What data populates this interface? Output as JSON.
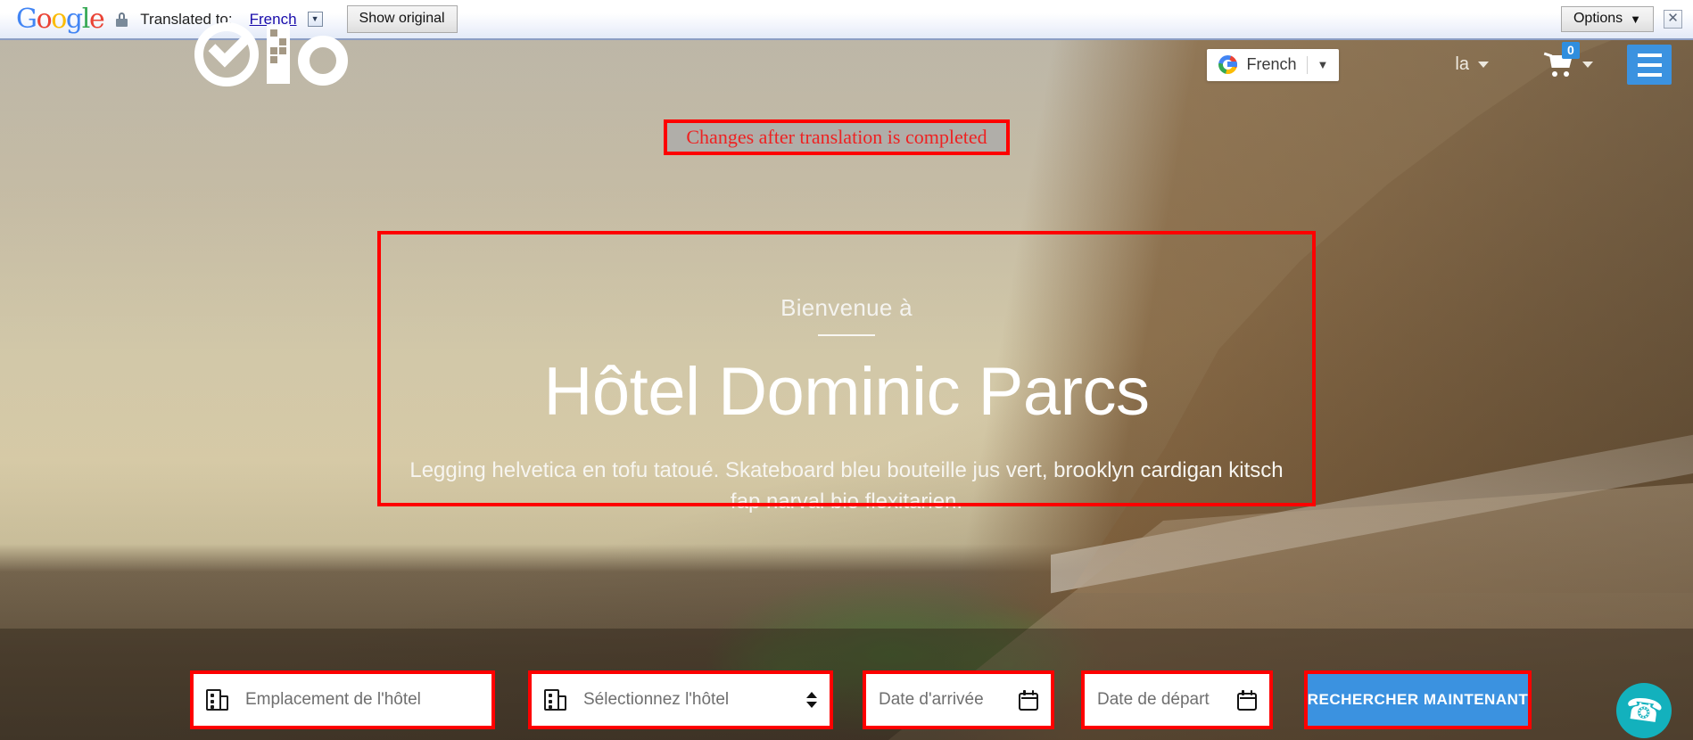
{
  "translate_bar": {
    "brand": "Google",
    "lock_icon": "lock-icon",
    "translated_label": "Translated to:",
    "language_link": "French",
    "language_caret": "▼",
    "show_original_label": "Show original",
    "options_label": "Options",
    "options_caret": "▼",
    "close_label": "✕"
  },
  "site_header": {
    "logo_name": "Qio",
    "language_selector": {
      "icon": "google-g-icon",
      "value": "French",
      "caret": "▼"
    },
    "account_label": "la",
    "cart": {
      "icon": "shopping-cart-icon",
      "count": "0"
    },
    "menu_icon": "hamburger-menu-icon"
  },
  "annotation": {
    "note_text": "Changes after translation is completed",
    "box_color": "#fe0000"
  },
  "hero": {
    "welcome": "Bienvenue à",
    "title": "Hôtel Dominic Parcs",
    "subtitle": "Legging helvetica en tofu tatoué. Skateboard bleu bouteille jus vert, brooklyn cardigan kitsch fap narval bio flexitarien."
  },
  "search_form": {
    "location_placeholder": "Emplacement de l'hôtel",
    "location_icon": "building-icon",
    "hotel_placeholder": "Sélectionnez l'hôtel",
    "hotel_icon": "building-icon",
    "arrival_placeholder": "Date d'arrivée",
    "arrival_icon": "calendar-icon",
    "departure_placeholder": "Date de départ",
    "departure_icon": "calendar-icon",
    "search_button_label": "RECHERCHER MAINTENANT",
    "search_button_color": "#3b92e0"
  },
  "phone_widget": {
    "icon": "phone-call-icon",
    "color": "#13b1bd"
  }
}
